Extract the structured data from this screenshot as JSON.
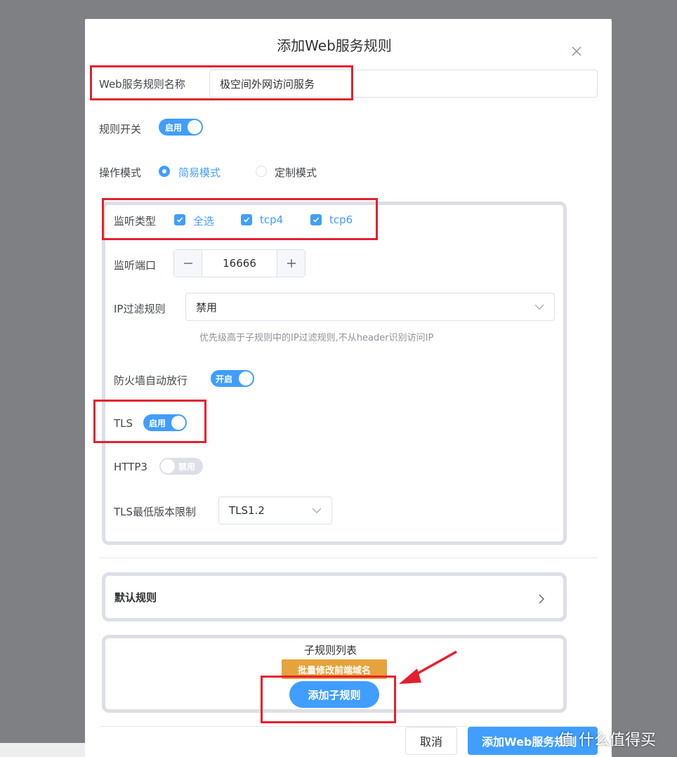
{
  "dialog": {
    "title": "添加Web服务规则"
  },
  "form": {
    "rule_name_label": "Web服务规则名称",
    "rule_name_value": "极空间外网访问服务",
    "rule_switch_label": "规则开关",
    "rule_switch_text": "启用",
    "mode_label": "操作模式",
    "mode_simple": "简易模式",
    "mode_custom": "定制模式"
  },
  "listen": {
    "type_label": "监听类型",
    "opt_all": "全选",
    "opt_tcp4": "tcp4",
    "opt_tcp6": "tcp6",
    "port_label": "监听端口",
    "port_value": "16666",
    "ip_filter_label": "IP过滤规则",
    "ip_filter_value": "禁用",
    "ip_filter_hint": "优先级高于子规则中的IP过滤规则,不从header识别访问IP",
    "firewall_label": "防火墙自动放行",
    "firewall_switch_text": "开启",
    "tls_label": "TLS",
    "tls_switch_text": "启用",
    "http3_label": "HTTP3",
    "http3_switch_text": "禁用",
    "tls_min_label": "TLS最低版本限制",
    "tls_min_value": "TLS1.2"
  },
  "default_rule": {
    "label": "默认规则"
  },
  "sub_rules": {
    "title": "子规则列表",
    "batch_button": "批量修改前端域名",
    "add_button": "添加子规则"
  },
  "footer": {
    "cancel_button": "取消",
    "confirm_button": "添加Web服务规则"
  },
  "watermark": "值 什么值得买",
  "colors": {
    "accent": "#409eff",
    "annotation_red": "#e5202e",
    "warning": "#e6a23c"
  }
}
